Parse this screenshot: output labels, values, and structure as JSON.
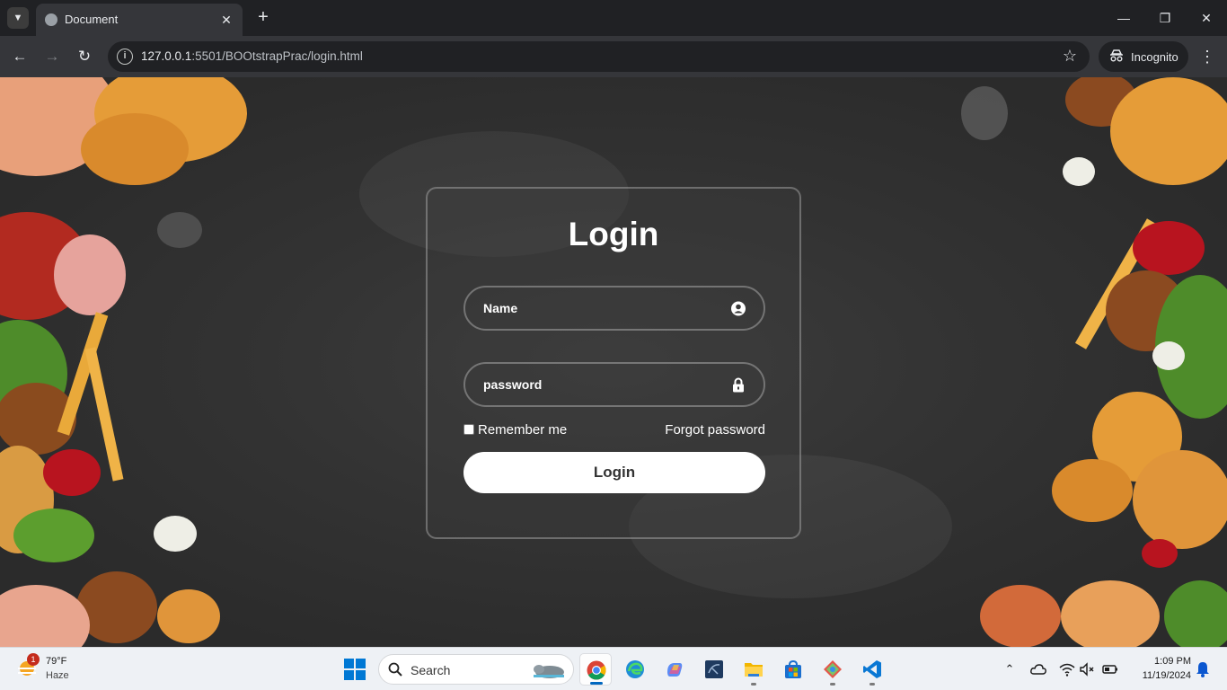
{
  "browser": {
    "tab_title": "Document",
    "url_host": "127.0.0.1",
    "url_path": ":5501/BOOtstrapPrac/login.html",
    "profile_label": "Incognito"
  },
  "login": {
    "title": "Login",
    "name_placeholder": "Name",
    "password_placeholder": "password",
    "remember_label": "Remember me",
    "forgot_label": "Forgot password",
    "submit_label": "Login"
  },
  "taskbar": {
    "weather_badge": "1",
    "weather_temp": "79°F",
    "weather_desc": "Haze",
    "search_label": "Search",
    "time": "1:09 PM",
    "date": "11/19/2024"
  },
  "icons": [
    "menu-chevron-icon",
    "globe-icon",
    "close-icon",
    "plus-icon",
    "minimize-icon",
    "restore-icon",
    "back-icon",
    "forward-icon",
    "reload-icon",
    "site-info-icon",
    "star-icon",
    "incognito-icon",
    "kebab-icon",
    "user-circle-icon",
    "lock-icon",
    "weather-icon",
    "windows-start-icon",
    "search-icon",
    "chrome-icon",
    "edge-icon",
    "copilot-icon",
    "sql-icon",
    "file-explorer-icon",
    "store-icon",
    "git-icon",
    "vscode-icon",
    "chevron-up-icon",
    "cloud-icon",
    "wifi-icon",
    "speaker-muted-icon",
    "battery-icon",
    "bell-icon"
  ]
}
